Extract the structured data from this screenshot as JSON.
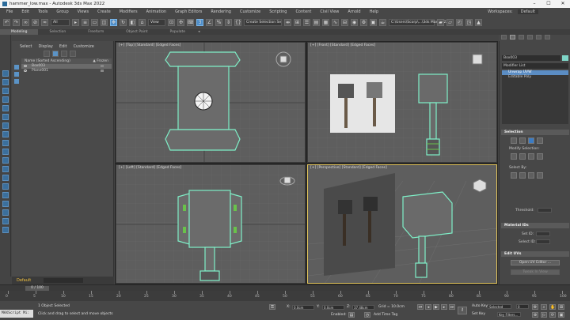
{
  "window": {
    "title": "hammer_low.max - Autodesk 3ds Max 2022",
    "minimize": "–",
    "maximize": "☐",
    "close": "✕"
  },
  "menu": {
    "items": [
      "File",
      "Edit",
      "Tools",
      "Group",
      "Views",
      "Create",
      "Modifiers",
      "Animation",
      "Graph Editors",
      "Rendering",
      "Customize",
      "Scripting",
      "Content",
      "Civil View",
      "Arnold",
      "Help"
    ],
    "workspaces_label": "Workspaces:",
    "workspaces_value": "Default"
  },
  "toolbar": {
    "filter": "All",
    "view": "View",
    "selection_set": "Create Selection Se",
    "path": "C:\\Users\\Scorp\\...\\3ds Max 2022"
  },
  "ribbon": {
    "tabs": [
      "Modeling",
      "Selection",
      "Freeform",
      "Object Paint",
      "Populate"
    ],
    "active": "Modeling"
  },
  "scene_explorer": {
    "menu": [
      "Select",
      "Display",
      "Edit",
      "Customize"
    ],
    "column_name": "Name (Sorted Ascending)",
    "column_frozen": "▲ Frozen",
    "rows": [
      {
        "name": "Box003",
        "selected": true
      },
      {
        "name": "Plane001",
        "selected": false
      }
    ]
  },
  "layer": {
    "name": "Default"
  },
  "viewports": {
    "top": "[+] [Top] [Standard] [Edged Faces]",
    "front": "[+] [Front] [Standard] [Edged Faces]",
    "left": "[+] [Left] [Standard] [Edged Faces]",
    "perspective": "[+] [Perspective] [Standard] [Edged Faces]"
  },
  "command_panel": {
    "object_name": "Box003",
    "object_color": "#7fd6c8",
    "modifier_list": "Modifier List",
    "stack": [
      "Unwrap UVW",
      "Editable Poly"
    ],
    "selection": {
      "header": "Selection",
      "modify_selection": "Modify Selection:",
      "select_by": "Select By:",
      "threshold": "Threshold:"
    },
    "material_ids": {
      "header": "Material IDs",
      "set_id": "Set ID:",
      "select_id": "Select ID:"
    },
    "edit_uvs": {
      "header": "Edit UVs",
      "open_editor": "Open UV Editor ...",
      "tweak": "Tweak In View"
    }
  },
  "timeline": {
    "slider": "0 / 100",
    "ticks": [
      "0",
      "5",
      "10",
      "15",
      "20",
      "25",
      "30",
      "35",
      "40",
      "45",
      "50",
      "55",
      "60",
      "65",
      "70",
      "75",
      "80",
      "85",
      "90",
      "95",
      "100"
    ]
  },
  "status": {
    "maxscript": "MAXScript Mi:",
    "objects_selected": "1 Object Selected",
    "prompt": "Click and drag to select and move objects",
    "x_label": "X:",
    "x_value": "0.0cm",
    "y_label": "Y:",
    "y_value": "0.0cm",
    "z_label": "Z:",
    "z_value": "37.48cm",
    "grid": "Grid = 10.0cm",
    "enabled": "Enabled:",
    "add_time_tag": "Add Time Tag",
    "auto_key": "Auto Key",
    "set_key": "Set Key",
    "selected": "Selected",
    "key_filters": "Key Filters...",
    "frame": "0"
  }
}
